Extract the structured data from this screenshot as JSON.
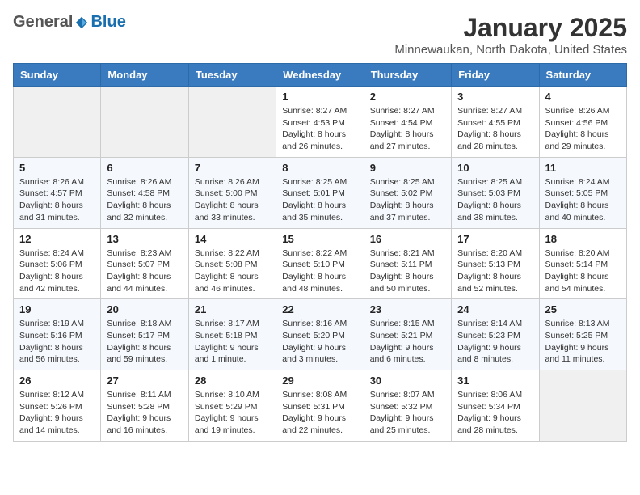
{
  "logo": {
    "general": "General",
    "blue": "Blue"
  },
  "header": {
    "title": "January 2025",
    "subtitle": "Minnewaukan, North Dakota, United States"
  },
  "weekdays": [
    "Sunday",
    "Monday",
    "Tuesday",
    "Wednesday",
    "Thursday",
    "Friday",
    "Saturday"
  ],
  "weeks": [
    [
      {
        "day": "",
        "info": ""
      },
      {
        "day": "",
        "info": ""
      },
      {
        "day": "",
        "info": ""
      },
      {
        "day": "1",
        "info": "Sunrise: 8:27 AM\nSunset: 4:53 PM\nDaylight: 8 hours and 26 minutes."
      },
      {
        "day": "2",
        "info": "Sunrise: 8:27 AM\nSunset: 4:54 PM\nDaylight: 8 hours and 27 minutes."
      },
      {
        "day": "3",
        "info": "Sunrise: 8:27 AM\nSunset: 4:55 PM\nDaylight: 8 hours and 28 minutes."
      },
      {
        "day": "4",
        "info": "Sunrise: 8:26 AM\nSunset: 4:56 PM\nDaylight: 8 hours and 29 minutes."
      }
    ],
    [
      {
        "day": "5",
        "info": "Sunrise: 8:26 AM\nSunset: 4:57 PM\nDaylight: 8 hours and 31 minutes."
      },
      {
        "day": "6",
        "info": "Sunrise: 8:26 AM\nSunset: 4:58 PM\nDaylight: 8 hours and 32 minutes."
      },
      {
        "day": "7",
        "info": "Sunrise: 8:26 AM\nSunset: 5:00 PM\nDaylight: 8 hours and 33 minutes."
      },
      {
        "day": "8",
        "info": "Sunrise: 8:25 AM\nSunset: 5:01 PM\nDaylight: 8 hours and 35 minutes."
      },
      {
        "day": "9",
        "info": "Sunrise: 8:25 AM\nSunset: 5:02 PM\nDaylight: 8 hours and 37 minutes."
      },
      {
        "day": "10",
        "info": "Sunrise: 8:25 AM\nSunset: 5:03 PM\nDaylight: 8 hours and 38 minutes."
      },
      {
        "day": "11",
        "info": "Sunrise: 8:24 AM\nSunset: 5:05 PM\nDaylight: 8 hours and 40 minutes."
      }
    ],
    [
      {
        "day": "12",
        "info": "Sunrise: 8:24 AM\nSunset: 5:06 PM\nDaylight: 8 hours and 42 minutes."
      },
      {
        "day": "13",
        "info": "Sunrise: 8:23 AM\nSunset: 5:07 PM\nDaylight: 8 hours and 44 minutes."
      },
      {
        "day": "14",
        "info": "Sunrise: 8:22 AM\nSunset: 5:08 PM\nDaylight: 8 hours and 46 minutes."
      },
      {
        "day": "15",
        "info": "Sunrise: 8:22 AM\nSunset: 5:10 PM\nDaylight: 8 hours and 48 minutes."
      },
      {
        "day": "16",
        "info": "Sunrise: 8:21 AM\nSunset: 5:11 PM\nDaylight: 8 hours and 50 minutes."
      },
      {
        "day": "17",
        "info": "Sunrise: 8:20 AM\nSunset: 5:13 PM\nDaylight: 8 hours and 52 minutes."
      },
      {
        "day": "18",
        "info": "Sunrise: 8:20 AM\nSunset: 5:14 PM\nDaylight: 8 hours and 54 minutes."
      }
    ],
    [
      {
        "day": "19",
        "info": "Sunrise: 8:19 AM\nSunset: 5:16 PM\nDaylight: 8 hours and 56 minutes."
      },
      {
        "day": "20",
        "info": "Sunrise: 8:18 AM\nSunset: 5:17 PM\nDaylight: 8 hours and 59 minutes."
      },
      {
        "day": "21",
        "info": "Sunrise: 8:17 AM\nSunset: 5:18 PM\nDaylight: 9 hours and 1 minute."
      },
      {
        "day": "22",
        "info": "Sunrise: 8:16 AM\nSunset: 5:20 PM\nDaylight: 9 hours and 3 minutes."
      },
      {
        "day": "23",
        "info": "Sunrise: 8:15 AM\nSunset: 5:21 PM\nDaylight: 9 hours and 6 minutes."
      },
      {
        "day": "24",
        "info": "Sunrise: 8:14 AM\nSunset: 5:23 PM\nDaylight: 9 hours and 8 minutes."
      },
      {
        "day": "25",
        "info": "Sunrise: 8:13 AM\nSunset: 5:25 PM\nDaylight: 9 hours and 11 minutes."
      }
    ],
    [
      {
        "day": "26",
        "info": "Sunrise: 8:12 AM\nSunset: 5:26 PM\nDaylight: 9 hours and 14 minutes."
      },
      {
        "day": "27",
        "info": "Sunrise: 8:11 AM\nSunset: 5:28 PM\nDaylight: 9 hours and 16 minutes."
      },
      {
        "day": "28",
        "info": "Sunrise: 8:10 AM\nSunset: 5:29 PM\nDaylight: 9 hours and 19 minutes."
      },
      {
        "day": "29",
        "info": "Sunrise: 8:08 AM\nSunset: 5:31 PM\nDaylight: 9 hours and 22 minutes."
      },
      {
        "day": "30",
        "info": "Sunrise: 8:07 AM\nSunset: 5:32 PM\nDaylight: 9 hours and 25 minutes."
      },
      {
        "day": "31",
        "info": "Sunrise: 8:06 AM\nSunset: 5:34 PM\nDaylight: 9 hours and 28 minutes."
      },
      {
        "day": "",
        "info": ""
      }
    ]
  ]
}
